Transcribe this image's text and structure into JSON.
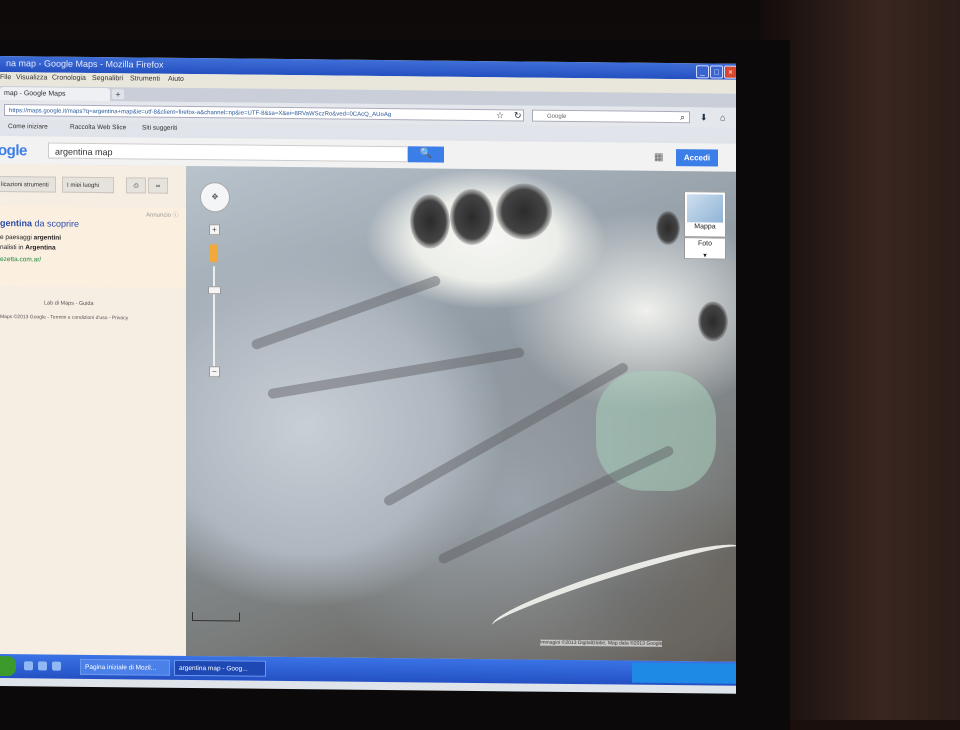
{
  "window": {
    "title": "na map - Google Maps - Mozilla Firefox",
    "minimize": "_",
    "maximize": "□",
    "close": "×"
  },
  "menu": [
    "File",
    "Visualizza",
    "Cronologia",
    "Segnalibri",
    "Strumenti",
    "Aiuto"
  ],
  "tab": {
    "label": "map - Google Maps",
    "new_tab": "+"
  },
  "nav": {
    "url": "https://maps.google.it/maps?q=argentina+map&ie=utf-8&client=firefox-a&channel=np&ie=UTF-8&sa=X&ei=8RVaWSczRo&ved=0CAcQ_AUoAg",
    "search_placeholder": "Google",
    "download": "⬇",
    "home": "⌂"
  },
  "bookmarks": [
    "Come iniziare",
    "Raccolta Web Slice",
    "Siti suggeriti"
  ],
  "google": {
    "logo": "ogle",
    "query": "argentina map",
    "search_icon": "🔍",
    "apps_icon": "▦",
    "signin": "Accedi"
  },
  "left_panel": {
    "btn_tools": "licazioni strumenti",
    "btn_places": "I miei luoghi",
    "print_icon": "⎙",
    "link_icon": "∞",
    "ad_label": "Annuncio ⓘ",
    "ad_title_strong": "gentina",
    "ad_title_rest": " da scoprire",
    "ad_line1_a": "e paesaggi ",
    "ad_line1_b": "argentini",
    "ad_line2_a": "nalisti in ",
    "ad_line2_b": "Argentina",
    "ad_url": "ezetta.com.ar/",
    "lab_link": "Lab di Maps - Guida",
    "footer": "Maps ©2013 Google - Termini e condizioni d'uso - Privacy"
  },
  "map": {
    "pan_icon": "✥",
    "zoom_in": "+",
    "zoom_out": "−",
    "maptype_label": "Mappa",
    "foto_label": "Foto",
    "foto_caret": "▾",
    "attribution": "Immagini ©2013 DigitalGlobe, Map data ©2013 Google"
  },
  "taskbar": {
    "tasks": [
      "Pagina iniziale di Mozil...",
      "argentina map - Goog..."
    ]
  },
  "colors": {
    "accent": "#3c7ee8",
    "link": "#2a4aa8",
    "ad_url": "#1a8a3a",
    "xp_blue": "#2451c4"
  }
}
